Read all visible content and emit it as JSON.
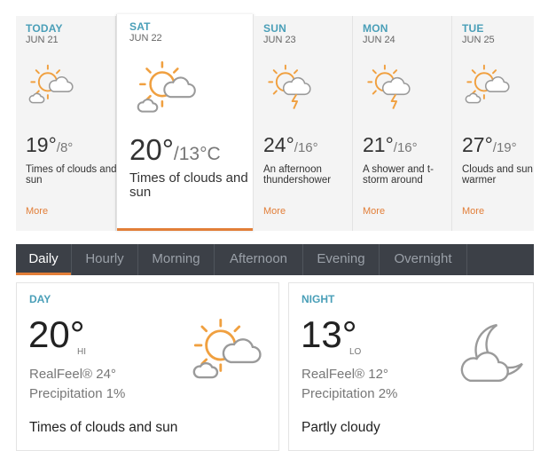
{
  "forecast": [
    {
      "dow": "TODAY",
      "date": "JUN 21",
      "hi": "19°",
      "lo": "/8°",
      "phrase": "Times of clouds and sun",
      "more": "More",
      "icon": "sun-cloud-icon"
    },
    {
      "dow": "SAT",
      "date": "JUN 22",
      "hi": "20°",
      "lo": "/13°C",
      "phrase": "Times of clouds and sun",
      "more": "",
      "icon": "sun-cloud-icon"
    },
    {
      "dow": "SUN",
      "date": "JUN 23",
      "hi": "24°",
      "lo": "/16°",
      "phrase": "An afternoon thundershower",
      "more": "More",
      "icon": "sun-cloud-lightning-icon"
    },
    {
      "dow": "MON",
      "date": "JUN 24",
      "hi": "21°",
      "lo": "/16°",
      "phrase": "A shower and t-storm around",
      "more": "More",
      "icon": "sun-cloud-lightning-icon"
    },
    {
      "dow": "TUE",
      "date": "JUN 25",
      "hi": "27°",
      "lo": "/19°",
      "phrase": "Clouds and sun warmer",
      "more": "More",
      "icon": "sun-cloud-icon"
    }
  ],
  "tabs": [
    "Daily",
    "Hourly",
    "Morning",
    "Afternoon",
    "Evening",
    "Overnight"
  ],
  "active_tab": "Daily",
  "day_panel": {
    "title": "DAY",
    "temp": "20°",
    "temp_sub": "HI",
    "realfeel": "RealFeel® 24°",
    "precip": "Precipitation 1%",
    "phrase": "Times of clouds and sun",
    "icon": "sun-cloud-icon"
  },
  "night_panel": {
    "title": "NIGHT",
    "temp": "13°",
    "temp_sub": "LO",
    "realfeel": "RealFeel® 12°",
    "precip": "Precipitation 2%",
    "phrase": "Partly cloudy",
    "icon": "moon-cloud-icon"
  },
  "colors": {
    "accent": "#e27e38",
    "label_blue": "#4a9fb8",
    "tab_bar": "#3c4047",
    "icon_orange": "#f0a040",
    "icon_gray": "#9a9a9a"
  }
}
